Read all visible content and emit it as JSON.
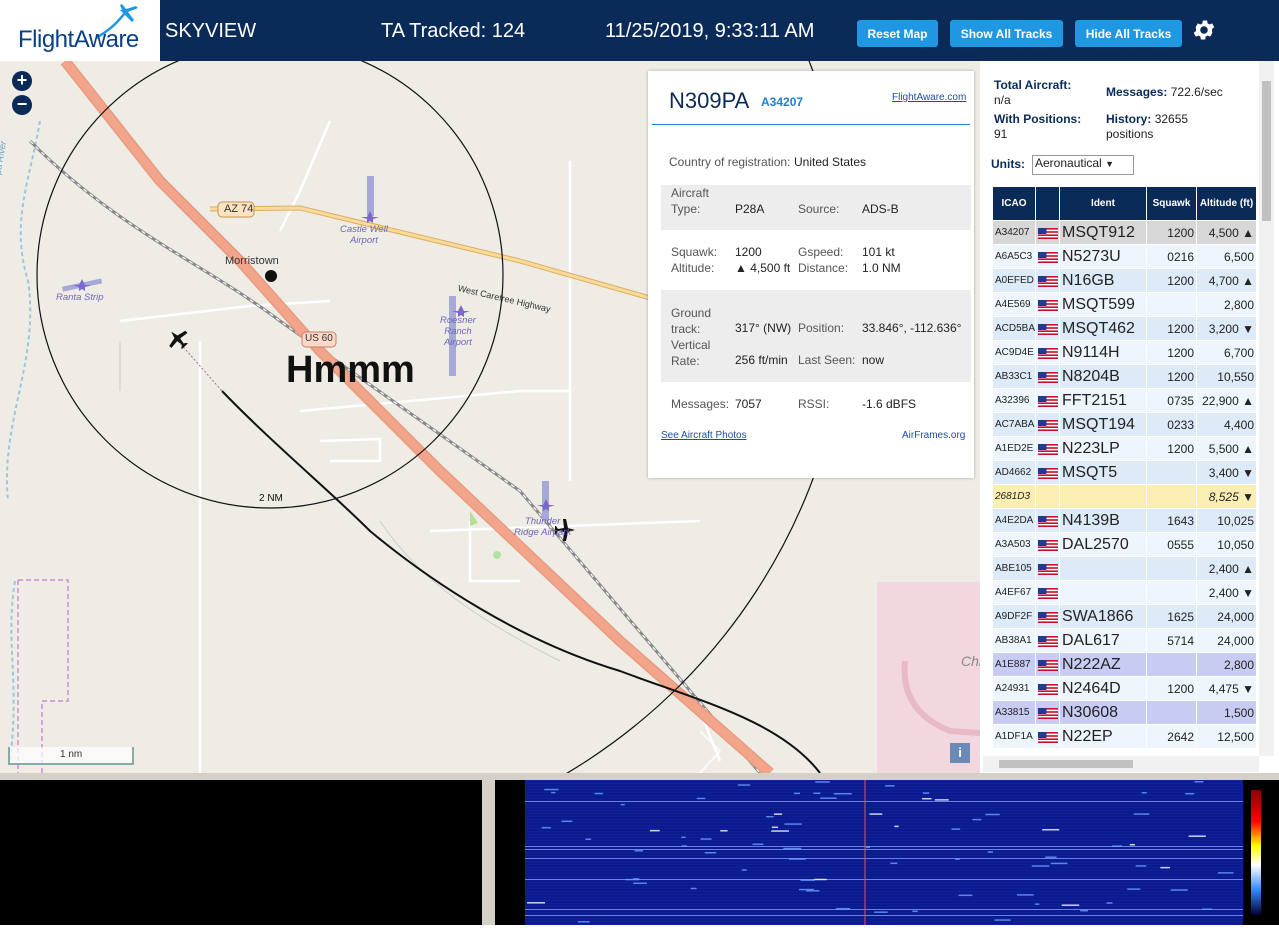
{
  "header": {
    "logo_text": "FlightAware",
    "app_name": "SKYVIEW",
    "tracked": "TA Tracked: 124",
    "datetime": "11/25/2019, 9:33:11 AM",
    "buttons": {
      "reset": "Reset Map",
      "show": "Show All Tracks",
      "hide": "Hide All Tracks"
    },
    "settings_icon": "gear-icon"
  },
  "map": {
    "zoom_in": "+",
    "zoom_out": "−",
    "overlay_text": "Hmmm",
    "scale": "1 nm",
    "ring_label": "2 NM",
    "info": "i",
    "labels": {
      "morristown": "Morristown",
      "az74": "AZ 74",
      "us60": "US 60",
      "carefree": "West Carefree Highway",
      "castle_well": "Castle Well\nAirport",
      "ranta": "Ranta Strip",
      "roesner": "Roesner\nRanch\nAirport",
      "thunder": "Thunder\nRidge Airpark",
      "hassayampa": "Hassayampa River",
      "chr": "Chr"
    }
  },
  "popup": {
    "callsign": "N309PA",
    "hex": "A34207",
    "fa_link": "FlightAware.com",
    "country_label": "Country of registration:",
    "country": "United States",
    "type_label": "Aircraft\nType:",
    "type": "P28A",
    "source_label": "Source:",
    "source": "ADS-B",
    "squawk_label": "Squawk:",
    "squawk": "1200",
    "gspeed_label": "Gspeed:",
    "gspeed": "101 kt",
    "altitude_label": "Altitude:",
    "altitude": "▲ 4,500 ft",
    "distance_label": "Distance:",
    "distance": "1.0 NM",
    "track_label": "Ground\ntrack:",
    "track": "317° (NW)",
    "position_label": "Position:",
    "position": "33.846°, -112.636°",
    "vrate_label": "Vertical\nRate:",
    "vrate": "256 ft/min",
    "lastseen_label": "Last Seen:",
    "lastseen": "now",
    "messages_label": "Messages:",
    "messages": "7057",
    "rssi_label": "RSSI:",
    "rssi": "-1.6 dBFS",
    "photos_link": "See Aircraft Photos",
    "airframes_link": "AirFrames.org"
  },
  "sidebar": {
    "total_label": "Total Aircraft:",
    "total": "n/a",
    "messages_label": "Messages:",
    "messages": "722.6/sec",
    "withpos_label": "With Positions:",
    "withpos": "91",
    "history_label": "History:",
    "history": "32655",
    "history_unit": "positions",
    "units_label": "Units:",
    "units_value": "Aeronautical",
    "columns": [
      "ICAO",
      "",
      "Ident",
      "Squawk",
      "Altitude (ft)"
    ],
    "rows": [
      {
        "icao": "A34207",
        "flag": true,
        "ident": "MSQT912",
        "squawk": "1200",
        "alt": "4,500 ▲",
        "style": "sel"
      },
      {
        "icao": "A6A5C3",
        "flag": true,
        "ident": "N5273U",
        "squawk": "0216",
        "alt": "6,500",
        "style": "r1"
      },
      {
        "icao": "A0EFED",
        "flag": true,
        "ident": "N16GB",
        "squawk": "1200",
        "alt": "4,700 ▲",
        "style": "r0"
      },
      {
        "icao": "A4E569",
        "flag": true,
        "ident": "MSQT599",
        "squawk": "",
        "alt": "2,800",
        "style": "r1"
      },
      {
        "icao": "ACD5BA",
        "flag": true,
        "ident": "MSQT462",
        "squawk": "1200",
        "alt": "3,200 ▼",
        "style": "r0"
      },
      {
        "icao": "AC9D4E",
        "flag": true,
        "ident": "N9114H",
        "squawk": "1200",
        "alt": "6,700",
        "style": "r1"
      },
      {
        "icao": "AB33C1",
        "flag": true,
        "ident": "N8204B",
        "squawk": "1200",
        "alt": "10,550",
        "style": "r0"
      },
      {
        "icao": "A32396",
        "flag": true,
        "ident": "FFT2151",
        "squawk": "0735",
        "alt": "22,900 ▲",
        "style": "r1"
      },
      {
        "icao": "AC7ABA",
        "flag": true,
        "ident": "MSQT194",
        "squawk": "0233",
        "alt": "4,400",
        "style": "r0"
      },
      {
        "icao": "A1ED2E",
        "flag": true,
        "ident": "N223LP",
        "squawk": "1200",
        "alt": "5,500 ▲",
        "style": "r1"
      },
      {
        "icao": "AD4662",
        "flag": true,
        "ident": "MSQT5",
        "squawk": "",
        "alt": "3,400 ▼",
        "style": "r0"
      },
      {
        "icao": "2681D3",
        "flag": false,
        "ident": "",
        "squawk": "",
        "alt": "8,525 ▼",
        "style": "nopos"
      },
      {
        "icao": "A4E2DA",
        "flag": true,
        "ident": "N4139B",
        "squawk": "1643",
        "alt": "10,025",
        "style": "r0"
      },
      {
        "icao": "A3A503",
        "flag": true,
        "ident": "DAL2570",
        "squawk": "0555",
        "alt": "10,050",
        "style": "r1"
      },
      {
        "icao": "ABE105",
        "flag": true,
        "ident": "",
        "squawk": "",
        "alt": "2,400 ▲",
        "style": "r0"
      },
      {
        "icao": "A4EF67",
        "flag": true,
        "ident": "",
        "squawk": "",
        "alt": "2,400 ▼",
        "style": "r1"
      },
      {
        "icao": "A9DF2F",
        "flag": true,
        "ident": "SWA1866",
        "squawk": "1625",
        "alt": "24,000",
        "style": "r0"
      },
      {
        "icao": "AB38A1",
        "flag": true,
        "ident": "DAL617",
        "squawk": "5714",
        "alt": "24,000",
        "style": "r1"
      },
      {
        "icao": "A1E887",
        "flag": true,
        "ident": "N222AZ",
        "squawk": "",
        "alt": "2,800",
        "style": "mlat"
      },
      {
        "icao": "A24931",
        "flag": true,
        "ident": "N2464D",
        "squawk": "1200",
        "alt": "4,475 ▼",
        "style": "r1"
      },
      {
        "icao": "A33815",
        "flag": true,
        "ident": "N30608",
        "squawk": "",
        "alt": "1,500",
        "style": "mlat"
      },
      {
        "icao": "A1DF1A",
        "flag": true,
        "ident": "N22EP",
        "squawk": "2642",
        "alt": "12,500",
        "style": "r1"
      }
    ]
  },
  "colors": {
    "header_bg": "#0a2b57",
    "button_bg": "#1f97e3",
    "selected_row": "#d7d7d7",
    "mlat_row": "#c8cbf2",
    "nopos_row": "#fbeeb2"
  }
}
